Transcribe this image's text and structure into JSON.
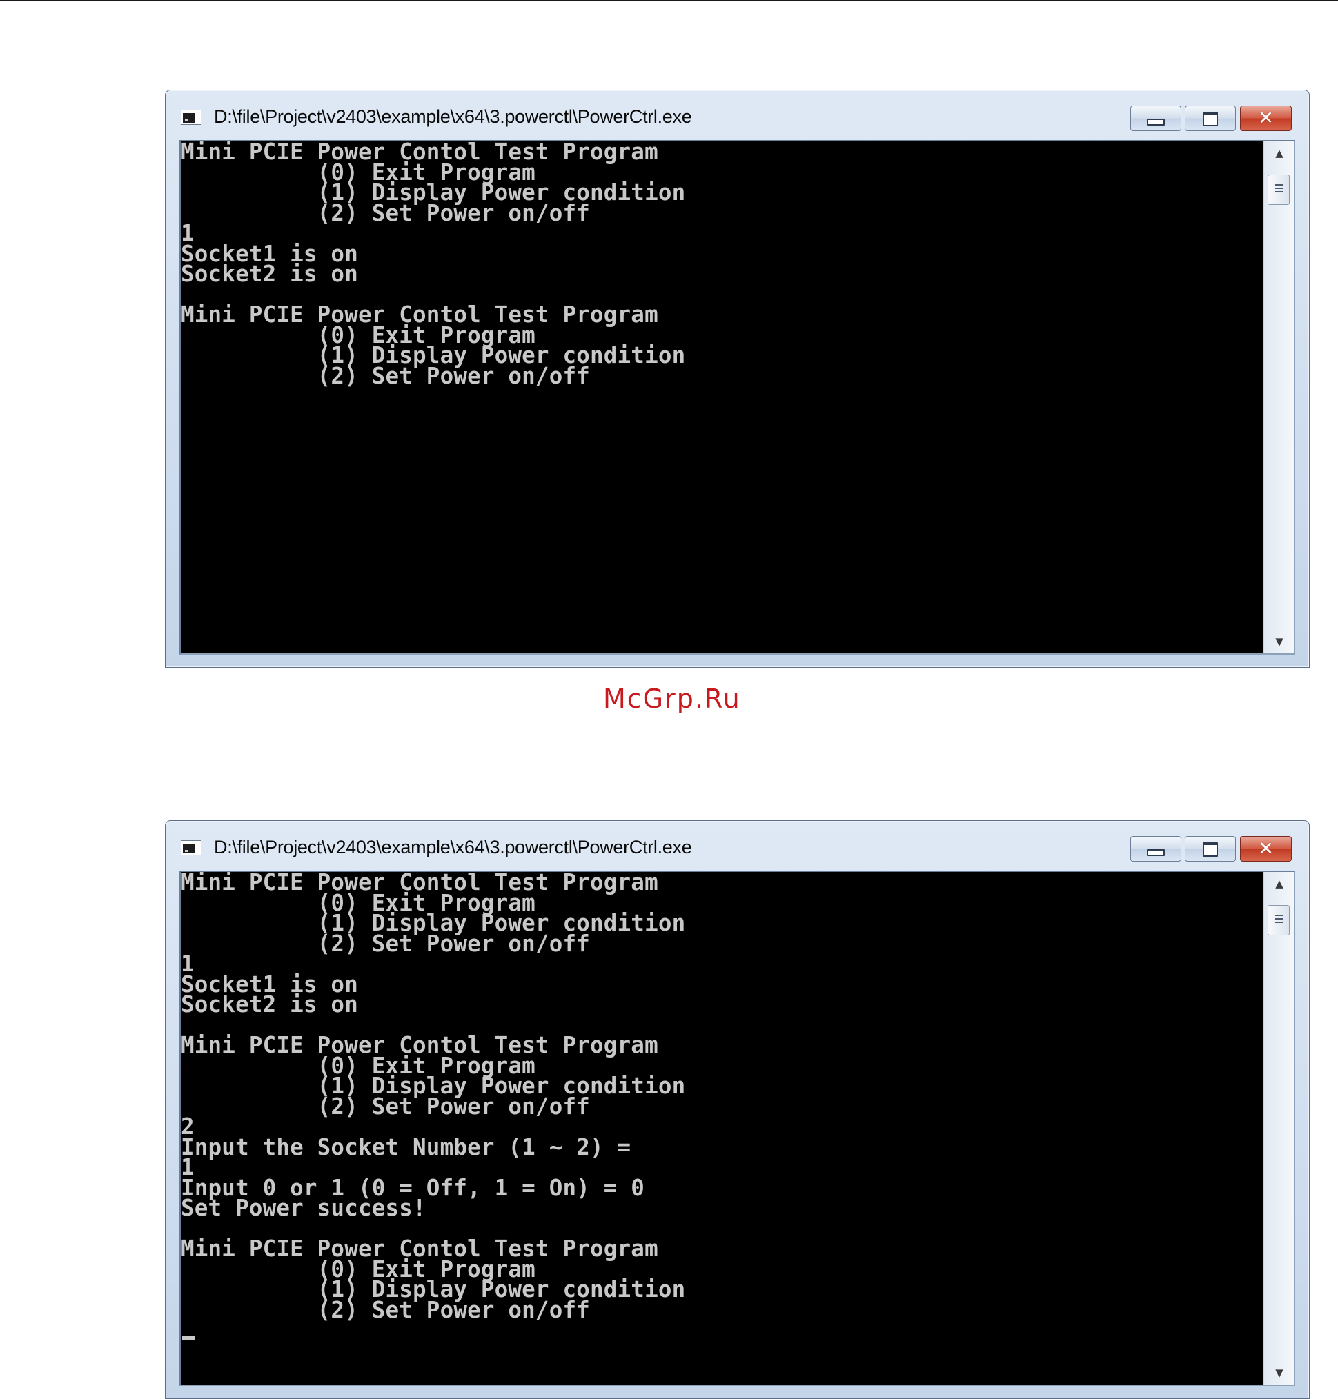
{
  "watermark": "McGrp.Ru",
  "windows": [
    {
      "title": "D:\\file\\Project\\v2403\\example\\x64\\3.powerctl\\PowerCtrl.exe",
      "console_text": "Mini PCIE Power Contol Test Program\n          (0) Exit Program\n          (1) Display Power condition\n          (2) Set Power on/off\n1\nSocket1 is on\nSocket2 is on\n\nMini PCIE Power Contol Test Program\n          (0) Exit Program\n          (1) Display Power condition\n          (2) Set Power on/off",
      "cursor_visible": false
    },
    {
      "title": "D:\\file\\Project\\v2403\\example\\x64\\3.powerctl\\PowerCtrl.exe",
      "console_text": "Mini PCIE Power Contol Test Program\n          (0) Exit Program\n          (1) Display Power condition\n          (2) Set Power on/off\n1\nSocket1 is on\nSocket2 is on\n\nMini PCIE Power Contol Test Program\n          (0) Exit Program\n          (1) Display Power condition\n          (2) Set Power on/off\n2\nInput the Socket Number (1 ~ 2) =\n1\nInput 0 or 1 (0 = Off, 1 = On) = 0\nSet Power success!\n\nMini PCIE Power Contol Test Program\n          (0) Exit Program\n          (1) Display Power condition\n          (2) Set Power on/off",
      "cursor_visible": true
    }
  ],
  "icons": {
    "app": "console-app-icon",
    "minimize": "minimize-icon",
    "maximize": "maximize-icon",
    "close": "close-icon",
    "scroll_up": "scroll-up-arrow-icon",
    "scroll_down": "scroll-down-arrow-icon"
  },
  "glyphs": {
    "close": "✕",
    "scroll_up": "▲",
    "scroll_down": "▼"
  },
  "colors": {
    "console_background": "#000000",
    "console_text": "#c8c8c8",
    "close_button": "#c13a22",
    "watermark": "#c8191f",
    "window_frame": "#c4d5ea"
  }
}
